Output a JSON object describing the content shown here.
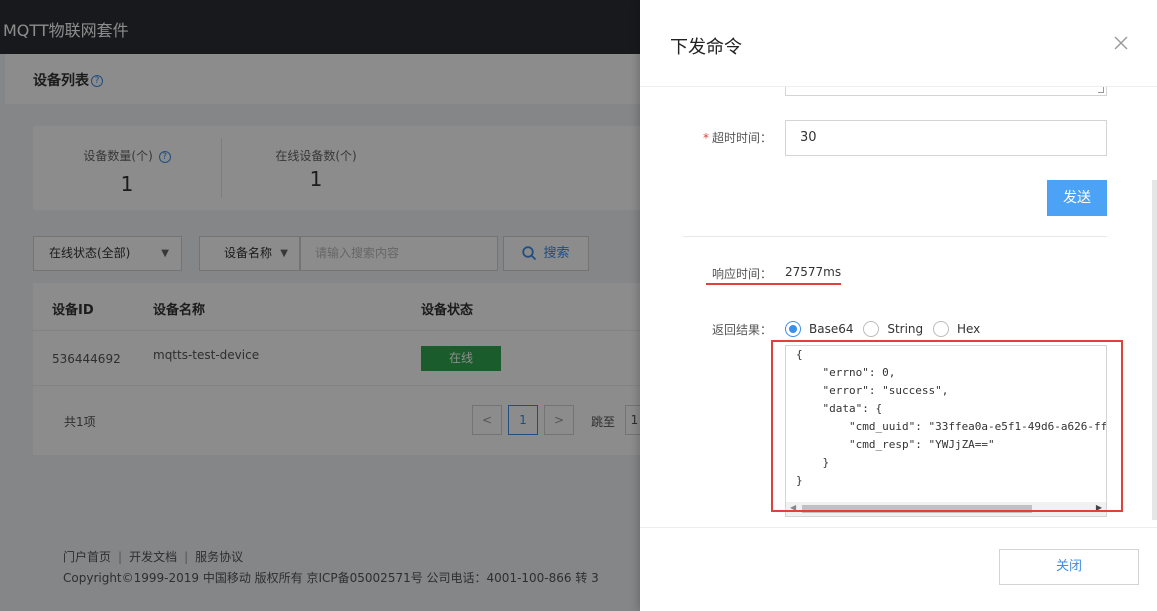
{
  "app": {
    "title": "MQTT物联网套件"
  },
  "page": {
    "title": "设备列表",
    "help_icon_glyph": "?"
  },
  "stats": {
    "device_count_label": "设备数量(个)",
    "device_count_value": "1",
    "online_count_label": "在线设备数(个)",
    "online_count_value": "1"
  },
  "filters": {
    "status_select": "在线状态(全部)",
    "field_select": "设备名称",
    "search_placeholder": "请输入搜索内容",
    "search_button": "搜索"
  },
  "table": {
    "headers": [
      "设备ID",
      "设备名称",
      "设备状态"
    ],
    "rows": [
      {
        "id": "536444692",
        "name": "mqtts-test-device",
        "status": "在线"
      }
    ],
    "total": "共1项",
    "pagination": {
      "prev": "<",
      "current": "1",
      "next": ">",
      "jump_label": "跳至",
      "jump_value": "1"
    }
  },
  "footer": {
    "links": [
      "门户首页",
      "开发文档",
      "服务协议"
    ],
    "copyright": "Copyright©1999-2019 中国移动 版权所有 京ICP备05002571号 公司电话：4001-100-866 转 3"
  },
  "drawer": {
    "title": "下发命令",
    "timeout_label": "超时时间：",
    "timeout_value": "30",
    "send_button": "发送",
    "response_time_label": "响应时间：",
    "response_time_value": "27577ms",
    "result_label": "返回结果：",
    "formats": [
      "Base64",
      "String",
      "Hex"
    ],
    "selected_format": "Base64",
    "result_lines": [
      "{",
      "    \"errno\": 0,",
      "    \"error\": \"success\",",
      "    \"data\": {",
      "        \"cmd_uuid\": \"33ffea0a-e5f1-49d6-a626-ff",
      "        \"cmd_resp\": \"YWJjZA==\"",
      "    }",
      "}"
    ],
    "close_button": "关闭"
  },
  "colors": {
    "accent": "#3b8eea",
    "send_button": "#4ca3f5",
    "online_badge": "#32a852",
    "highlight": "#e0413c",
    "header_bg": "#2b2f36"
  }
}
